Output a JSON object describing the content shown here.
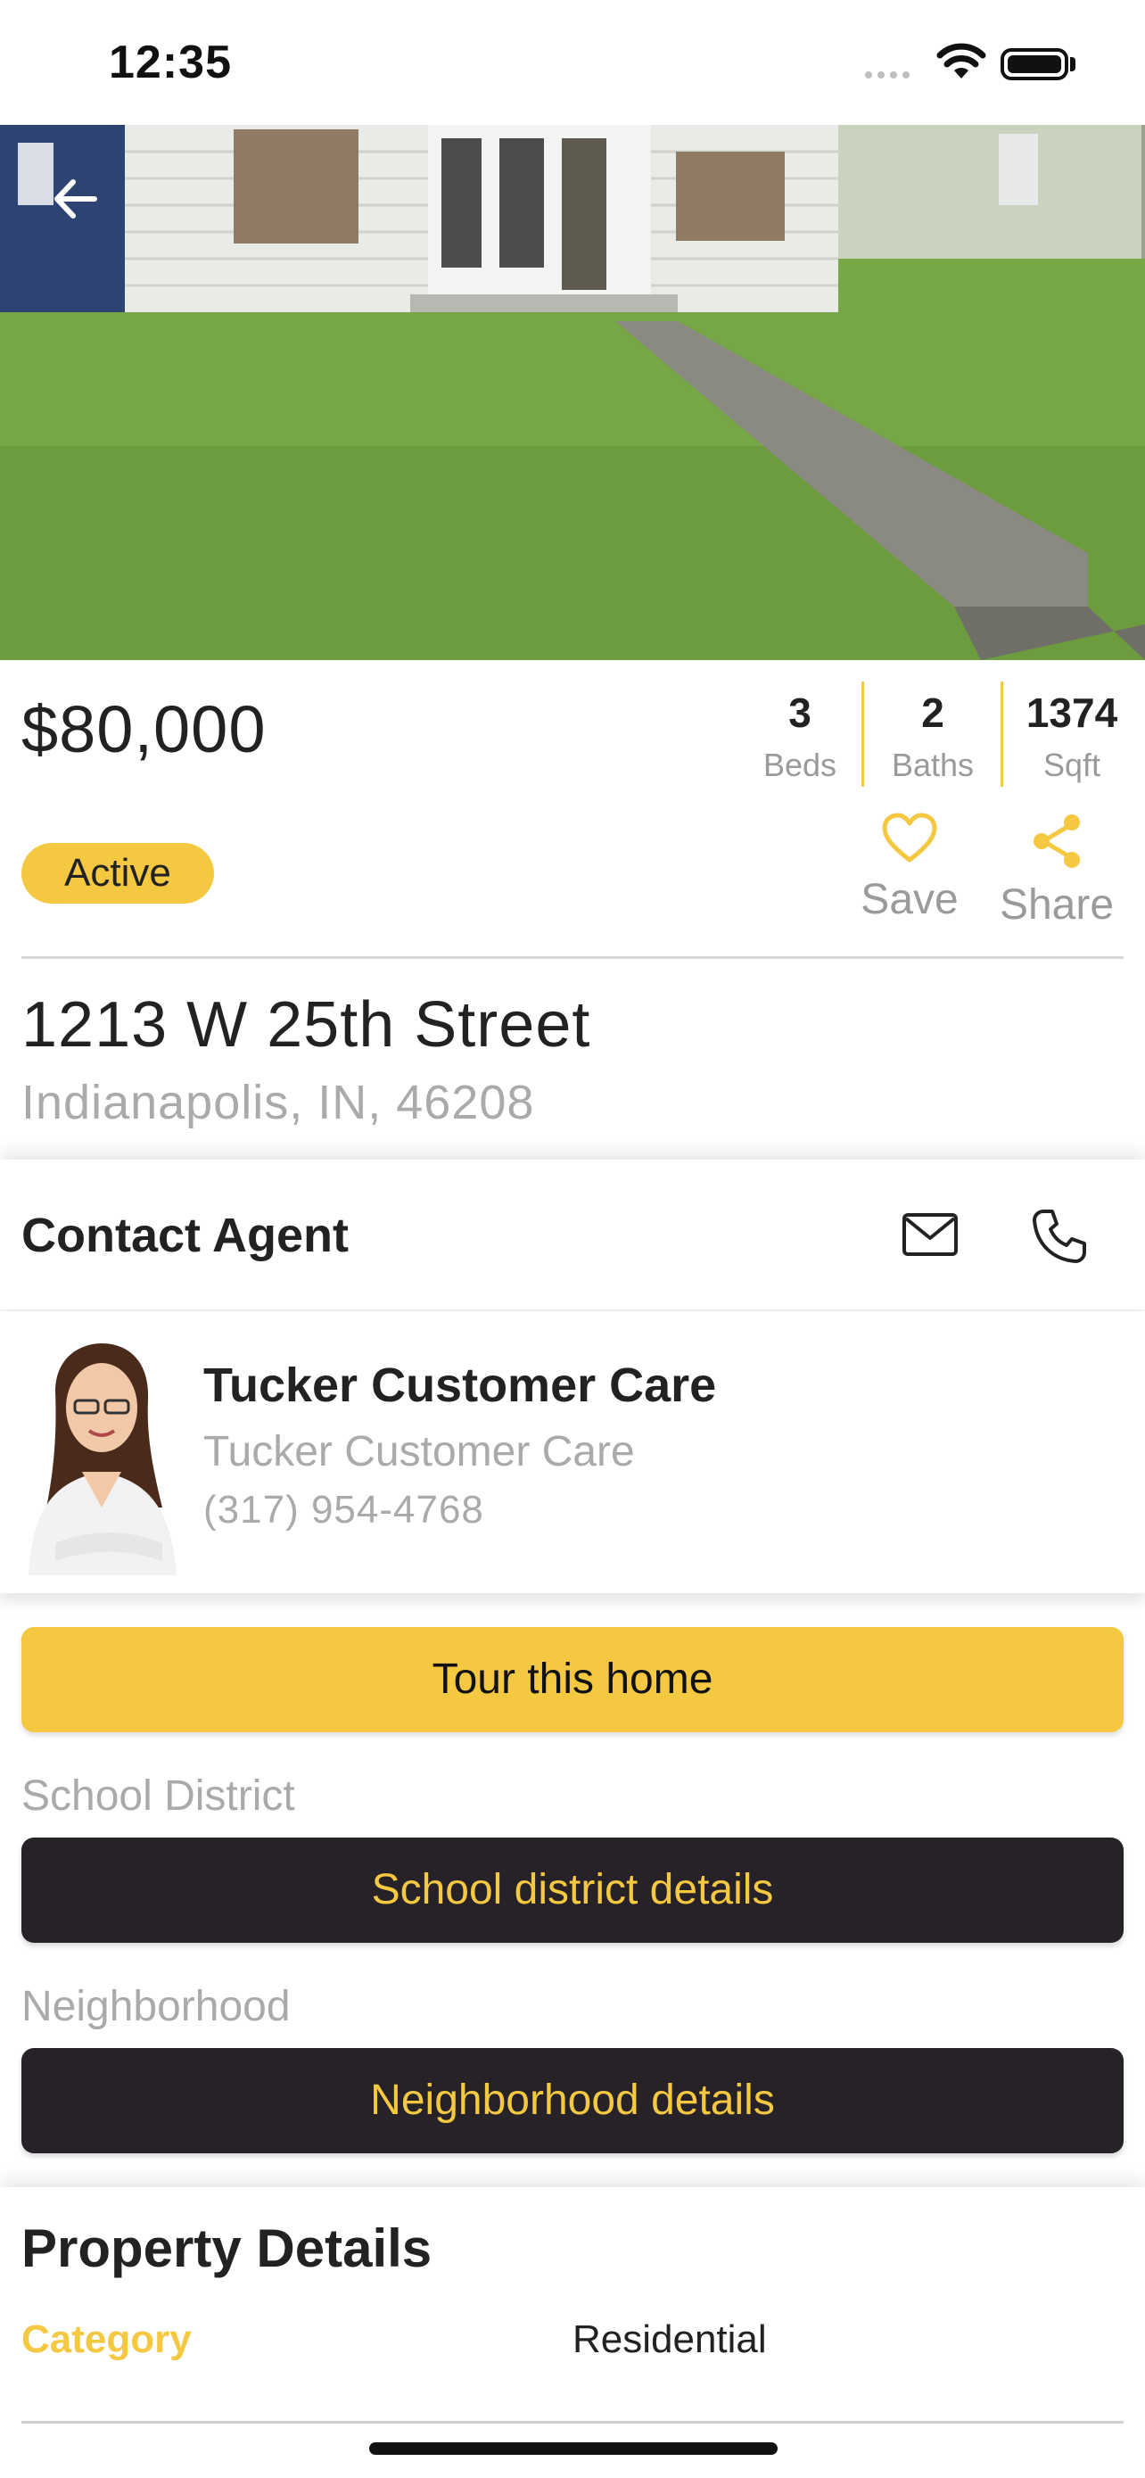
{
  "status": {
    "time": "12:35"
  },
  "listing": {
    "price": "$80,000",
    "beds": {
      "value": "3",
      "label": "Beds"
    },
    "baths": {
      "value": "2",
      "label": "Baths"
    },
    "sqft": {
      "value": "1374",
      "label": "Sqft"
    },
    "status_badge": "Active",
    "save_label": "Save",
    "share_label": "Share",
    "street": "1213 W 25th Street",
    "city": "Indianapolis, IN, 46208"
  },
  "contact": {
    "title": "Contact Agent",
    "agent_name": "Tucker Customer Care",
    "agent_company": "Tucker Customer Care",
    "agent_phone": "(317) 954-4768"
  },
  "actions": {
    "tour_label": "Tour this home",
    "school_section": "School District",
    "school_button": "School district details",
    "neighborhood_section": "Neighborhood",
    "neighborhood_button": "Neighborhood details"
  },
  "property_details": {
    "title": "Property Details",
    "rows": [
      {
        "label": "Category",
        "value": "Residential"
      }
    ]
  },
  "colors": {
    "accent": "#f5c842",
    "dark_button": "#262227",
    "muted_text": "#aaaaaa"
  },
  "icons": [
    "back-arrow-icon",
    "heart-icon",
    "share-icon",
    "mail-icon",
    "phone-icon",
    "wifi-icon",
    "battery-icon",
    "signal-icon"
  ]
}
